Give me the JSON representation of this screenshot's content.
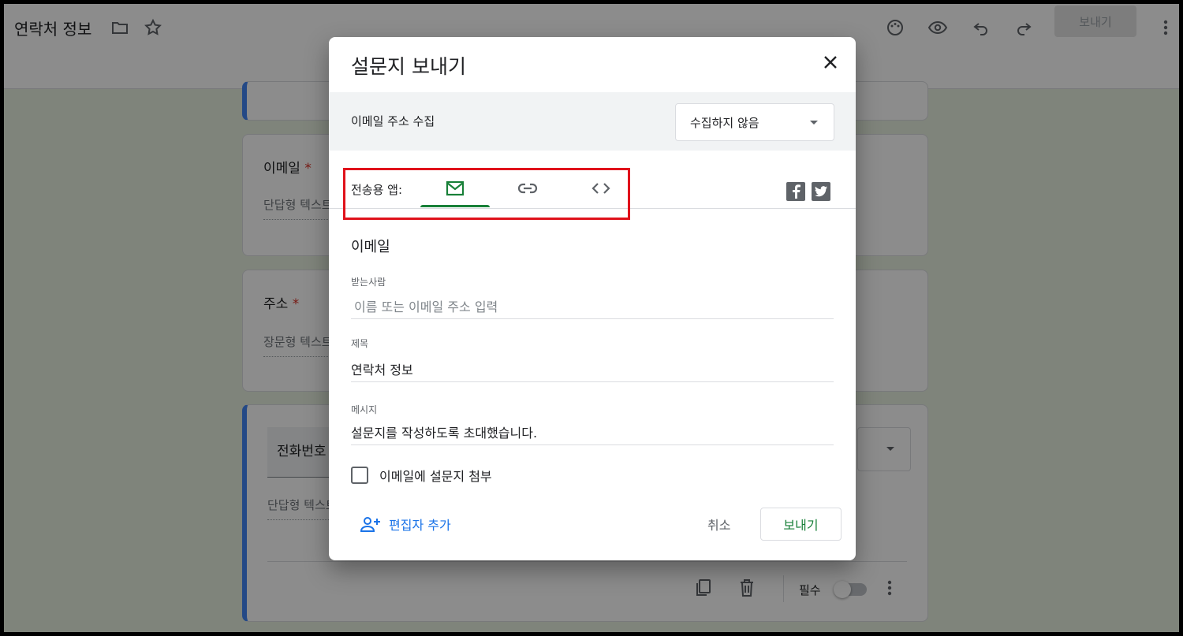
{
  "app": {
    "doc_title": "연락처 정보",
    "send_button": "보내기"
  },
  "form": {
    "email_question": {
      "title": "이메일",
      "required_mark": "*",
      "answer_hint": "단답형 텍스트"
    },
    "address_question": {
      "title": "주소",
      "required_mark": "*",
      "answer_hint": "장문형 텍스트"
    },
    "phone_question": {
      "title": "전화번호",
      "answer_hint": "단답형 텍스트"
    },
    "required_label": "필수"
  },
  "dialog": {
    "title": "설문지 보내기",
    "collect_email_label": "이메일 주소 수집",
    "collect_email_value": "수집하지 않음",
    "send_via_label": "전송용 앱:",
    "send_tabs": [
      "email-icon",
      "link-icon",
      "embed-icon"
    ],
    "active_tab": "email",
    "section_title": "이메일",
    "to_label": "받는사람",
    "to_placeholder": "이름 또는 이메일 주소 입력",
    "subject_label": "제목",
    "subject_value": "연락처 정보",
    "message_label": "메시지",
    "message_value": "설문지를 작성하도록 초대했습니다.",
    "attach_label": "이메일에 설문지 첨부",
    "attach_checked": false,
    "add_editor": "편집자 추가",
    "cancel": "취소",
    "send": "보내기"
  },
  "colors": {
    "accent_green": "#188038",
    "link_blue": "#1a73e8",
    "highlight_red": "#e0121b"
  }
}
